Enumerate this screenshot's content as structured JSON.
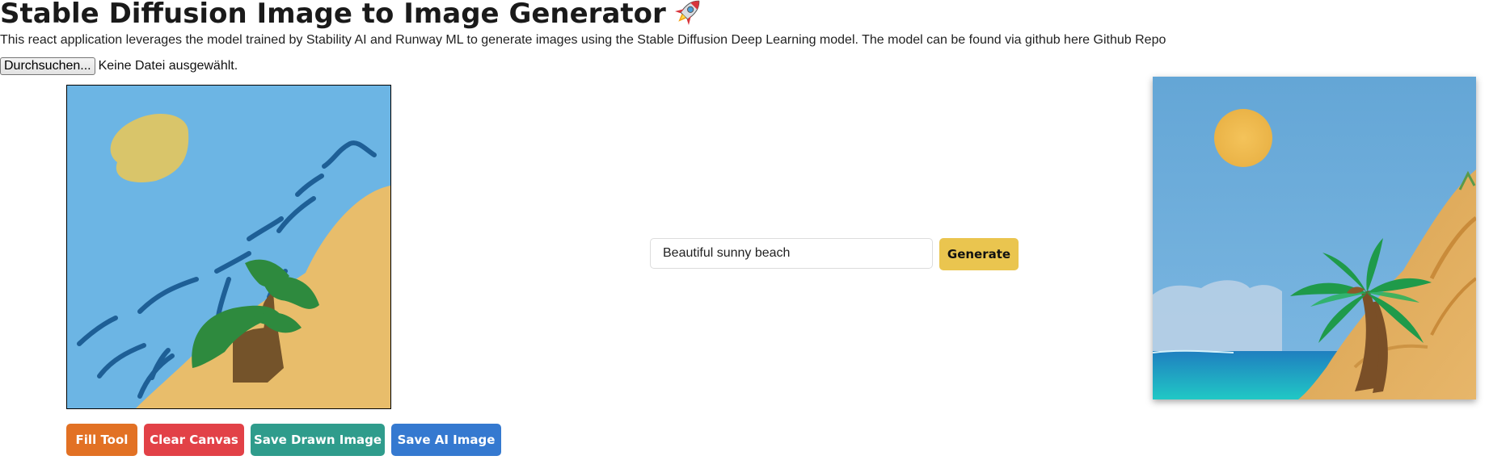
{
  "header": {
    "title": "Stable Diffusion Image to Image Generator",
    "title_icon": "rocket-icon",
    "description": "This react application leverages the model trained by Stability AI and Runway ML to generate images using the Stable Diffusion Deep Learning model. The model can be found via github here Github Repo"
  },
  "file_input": {
    "button_label": "Durchsuchen...",
    "status_text": "Keine Datei ausgewählt."
  },
  "prompt": {
    "value": "Beautiful sunny beach",
    "generate_label": "Generate"
  },
  "toolbar": {
    "fill_label": "Fill Tool",
    "clear_label": "Clear Canvas",
    "save_drawn_label": "Save Drawn Image",
    "save_ai_label": "Save AI Image"
  },
  "colors": {
    "fill_button": "#e27124",
    "clear_button": "#e24147",
    "save_drawn_button": "#2f9c8c",
    "save_ai_button": "#3579d0",
    "generate_button": "#eac54f"
  }
}
